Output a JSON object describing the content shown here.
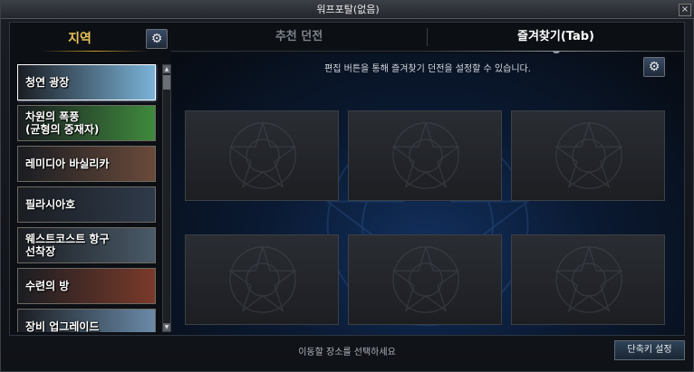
{
  "window": {
    "title": "워프포탈(없음)",
    "close_label": "×"
  },
  "left_panel": {
    "title": "지역",
    "settings_icon": "gear-icon",
    "zones": [
      {
        "label": "청연 광장",
        "selected": true,
        "color": "#7bb3d8"
      },
      {
        "label": "차원의 폭풍\n(균형의 중재자)",
        "selected": false,
        "color": "#3f8a3c"
      },
      {
        "label": "레미디아 바실리카",
        "selected": false,
        "color": "#6a4a3a"
      },
      {
        "label": "필라시아호",
        "selected": false,
        "color": "#2f3a4a"
      },
      {
        "label": "웨스트코스트 항구\n선착장",
        "selected": false,
        "color": "#4a5a68"
      },
      {
        "label": "수련의 방",
        "selected": false,
        "color": "#7a3a2a"
      },
      {
        "label": "장비 업그레이드",
        "selected": false,
        "color": "#6a8aa8"
      }
    ]
  },
  "tabs": [
    {
      "label": "추천 던전",
      "active": false
    },
    {
      "label": "즐겨찾기(Tab)",
      "active": true
    }
  ],
  "favorites": {
    "info_text": "편집 버튼을 통해 즐겨찾기 던전을 설정할 수 있습니다.",
    "edit_icon": "gear-icon",
    "slots": 6
  },
  "bottom": {
    "status_text": "이동할 장소를 선택하세요",
    "shortcut_label": "단축키 설정"
  },
  "colors": {
    "accent_gold": "#e9c25a",
    "background": "#0c0f14"
  }
}
